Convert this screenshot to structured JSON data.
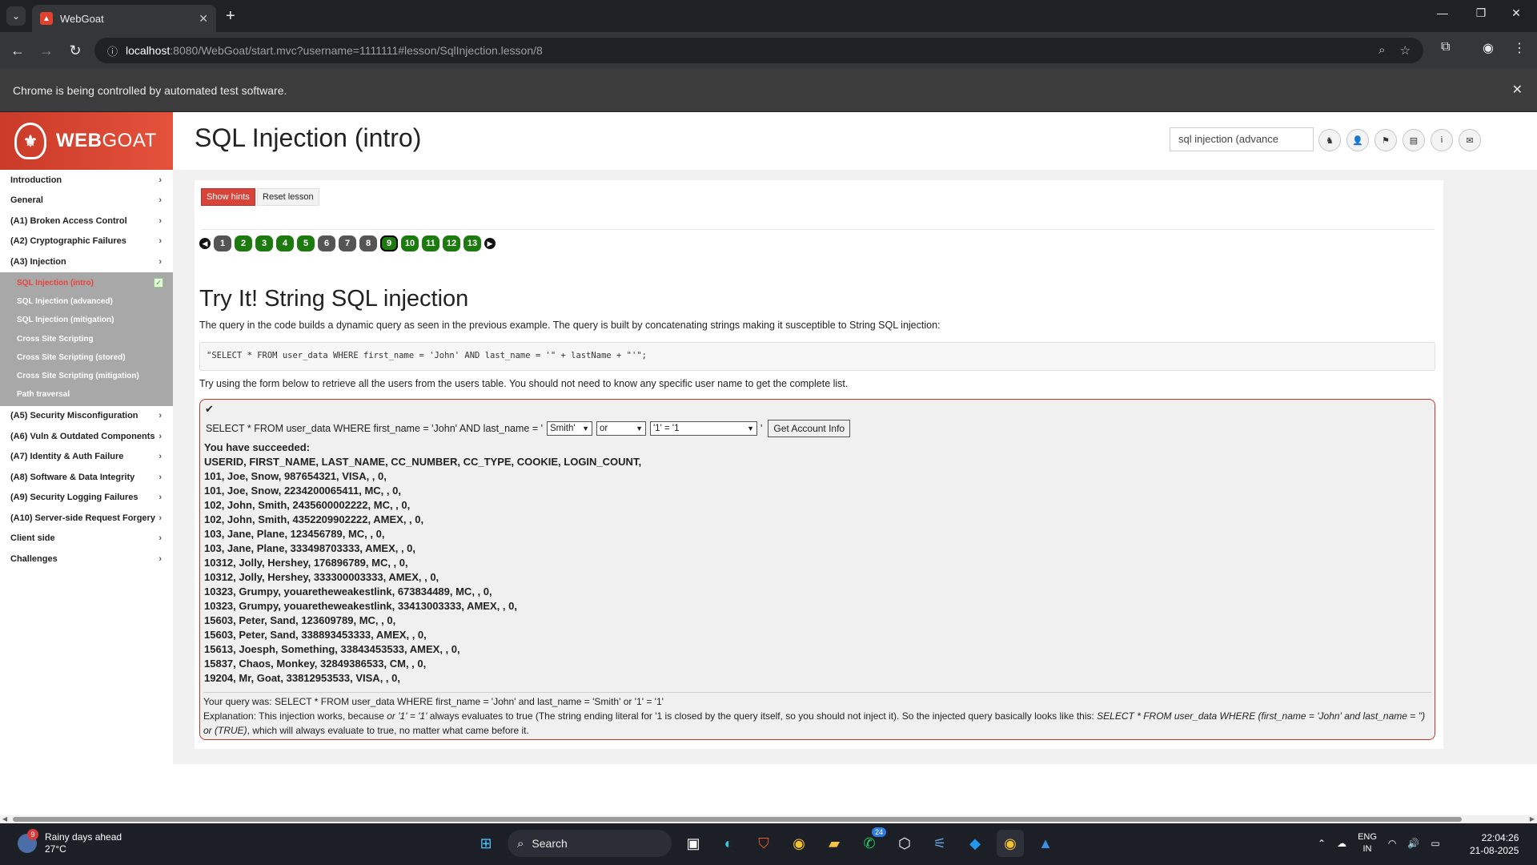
{
  "browser": {
    "tab_title": "WebGoat",
    "url_host": "localhost",
    "url_path": ":8080/WebGoat/start.mvc?username=1111111#lesson/SqlInjection.lesson/8",
    "infobar_text": "Chrome is being controlled by automated test software."
  },
  "app": {
    "logo_text_bold": "WEB",
    "logo_text_rest": "GOAT",
    "page_title": "SQL Injection (intro)",
    "search_value": "sql injection (advance"
  },
  "sidebar": {
    "items_top": [
      "Introduction",
      "General",
      "(A1) Broken Access Control",
      "(A2) Cryptographic Failures",
      "(A3) Injection"
    ],
    "submenu": [
      "SQL Injection (intro)",
      "SQL Injection (advanced)",
      "SQL Injection (mitigation)",
      "Cross Site Scripting",
      "Cross Site Scripting (stored)",
      "Cross Site Scripting (mitigation)",
      "Path traversal"
    ],
    "items_bottom": [
      "(A5) Security Misconfiguration",
      "(A6) Vuln & Outdated Components",
      "(A7) Identity & Auth Failure",
      "(A8) Software & Data Integrity",
      "(A9) Security Logging Failures",
      "(A10) Server-side Request Forgery",
      "Client side",
      "Challenges"
    ]
  },
  "lesson": {
    "show_hints": "Show hints",
    "reset_lesson": "Reset lesson",
    "pages": [
      "1",
      "2",
      "3",
      "4",
      "5",
      "6",
      "7",
      "8",
      "9",
      "10",
      "11",
      "12",
      "13"
    ],
    "current_page": "9",
    "heading": "Try It! String SQL injection",
    "para1": "The query in the code builds a dynamic query as seen in the previous example. The query is built by concatenating strings making it susceptible to String SQL injection:",
    "code": "\"SELECT * FROM user_data WHERE first_name = 'John' AND last_name = '\" + lastName + \"'\";",
    "para2": "Try using the form below to retrieve all the users from the users table. You should not need to know any specific user name to get the complete list."
  },
  "attack": {
    "query_prefix": "SELECT * FROM user_data WHERE first_name = 'John' AND last_name = '",
    "select1": "Smith'",
    "select2": "or",
    "select3": "'1' = '1",
    "query_suffix": "'",
    "button": "Get Account Info",
    "success": "You have succeeded:",
    "header_row": "USERID, FIRST_NAME, LAST_NAME, CC_NUMBER, CC_TYPE, COOKIE, LOGIN_COUNT,",
    "rows": [
      "101, Joe, Snow, 987654321, VISA, , 0,",
      "101, Joe, Snow, 2234200065411, MC, , 0,",
      "102, John, Smith, 2435600002222, MC, , 0,",
      "102, John, Smith, 4352209902222, AMEX, , 0,",
      "103, Jane, Plane, 123456789, MC, , 0,",
      "103, Jane, Plane, 333498703333, AMEX, , 0,",
      "10312, Jolly, Hershey, 176896789, MC, , 0,",
      "10312, Jolly, Hershey, 333300003333, AMEX, , 0,",
      "10323, Grumpy, youaretheweakestlink, 673834489, MC, , 0,",
      "10323, Grumpy, youaretheweakestlink, 33413003333, AMEX, , 0,",
      "15603, Peter, Sand, 123609789, MC, , 0,",
      "15603, Peter, Sand, 338893453333, AMEX, , 0,",
      "15613, Joesph, Something, 33843453533, AMEX, , 0,",
      "15837, Chaos, Monkey, 32849386533, CM, , 0,",
      "19204, Mr, Goat, 33812953533, VISA, , 0,"
    ],
    "your_query": "Your query was: SELECT * FROM user_data WHERE first_name = 'John' and last_name = 'Smith' or '1' = '1'",
    "expl_1": "Explanation: This injection works, because ",
    "expl_2": "or '1' = '1'",
    "expl_3": " always evaluates to true (The string ending literal for '1 is closed by the query itself, so you should not inject it). So the injected query basically looks like this: ",
    "expl_4": "SELECT * FROM user_data WHERE (first_name = 'John' and last_name = '') or (TRUE)",
    "expl_5": ", which will always evaluate to true, no matter what came before it."
  },
  "taskbar": {
    "weather_title": "Rainy days ahead",
    "weather_temp": "27°C",
    "weather_badge": "9",
    "search": "Search",
    "whatsapp_badge": "24",
    "lang1": "ENG",
    "lang2": "IN",
    "time": "22:04:26",
    "date": "21-08-2025"
  },
  "colors": {
    "accent_red": "#d9443a",
    "pager_green": "#1d7a0f",
    "submenu_grey": "#a8a8a8"
  }
}
